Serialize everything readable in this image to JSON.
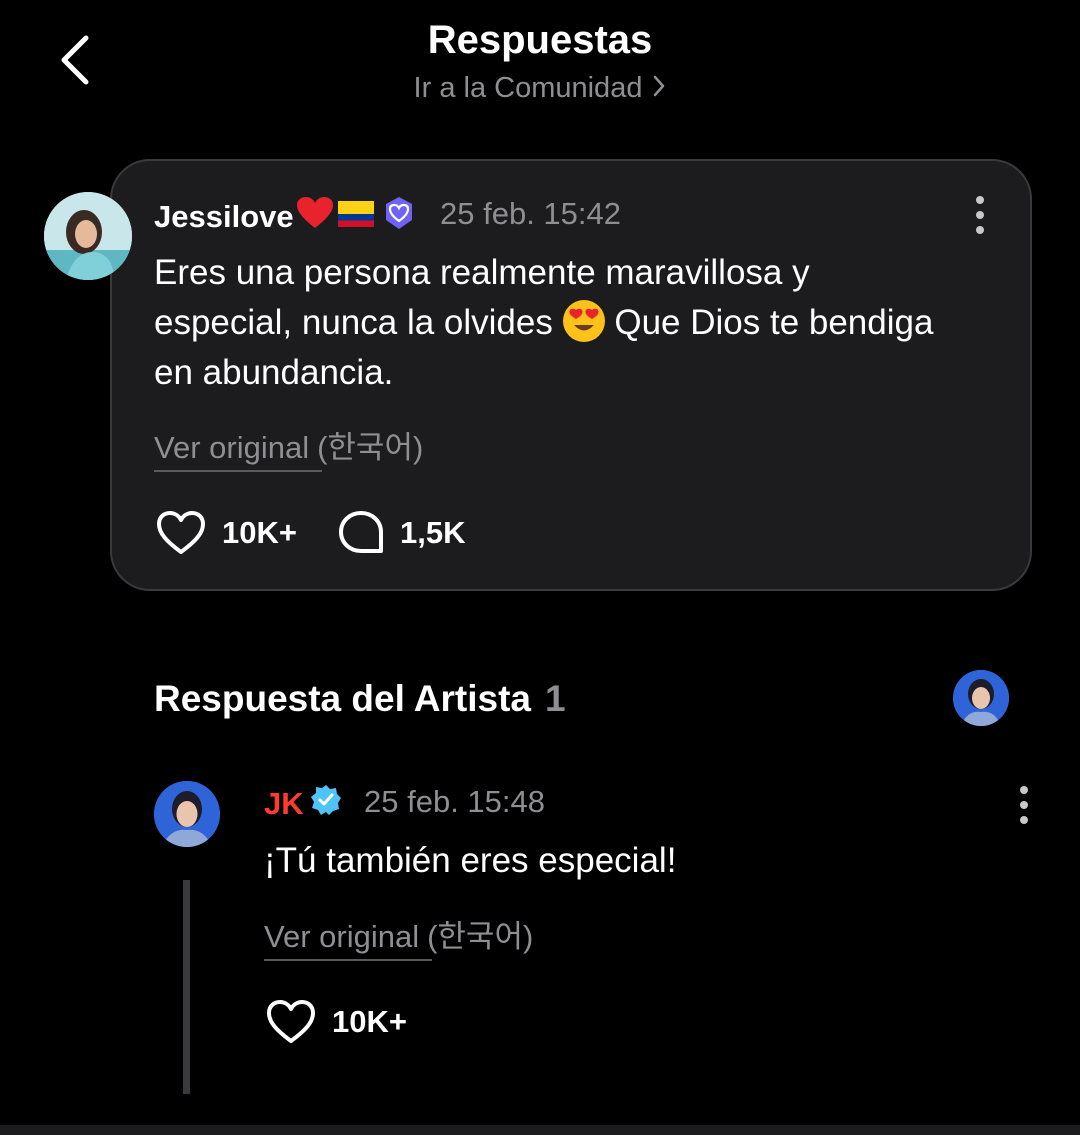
{
  "header": {
    "title": "Respuestas",
    "community_link": "Ir a la Comunidad"
  },
  "post": {
    "author": "Jessilove",
    "author_badges": [
      "heart-emoji",
      "colombia-flag-emoji",
      "verified-heart-badge-icon"
    ],
    "timestamp": "25 feb. 15:42",
    "text_line1": "Eres una persona realmente maravillosa y",
    "text_line2_a": "especial, nunca la olvides",
    "text_line2_b": "Que Dios te bendiga",
    "text_line3": "en abundancia.",
    "emoji": "heart-eyes-emoji",
    "view_original": "Ver original",
    "original_language": "(한국어)",
    "likes": "10K+",
    "comments": "1,5K"
  },
  "artist_section": {
    "title": "Respuesta del Artista",
    "count": "1"
  },
  "reply": {
    "author": "JK",
    "author_badge": "verified-check-icon",
    "timestamp": "25 feb. 15:48",
    "text": "¡Tú también eres especial!",
    "view_original": "Ver original",
    "original_language": "(한국어)",
    "likes": "10K+"
  },
  "colors": {
    "background": "#000000",
    "card": "#1c1c1e",
    "muted_text": "#8e8e93",
    "artist_name": "#ff3b30",
    "verified": "#4fc3f7",
    "badge_purple": "#6f63f6"
  }
}
